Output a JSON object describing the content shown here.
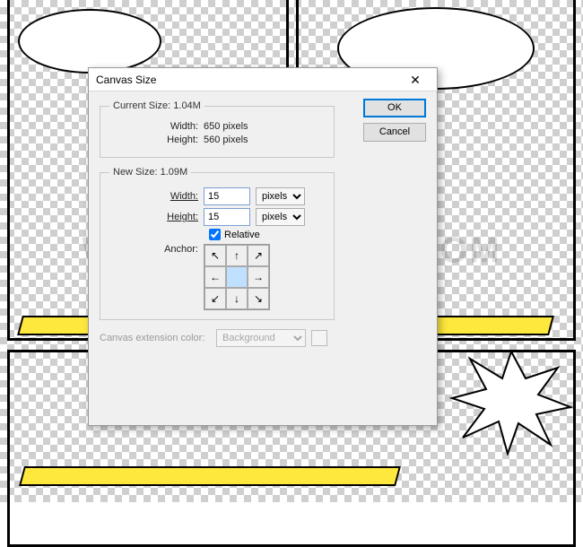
{
  "watermark": "WWW.PSD-DUDE.COM",
  "dialog": {
    "title": "Canvas Size",
    "close_glyph": "✕",
    "current": {
      "legend": "Current Size:",
      "size": "1.04M",
      "width_label": "Width:",
      "width_value": "650 pixels",
      "height_label": "Height:",
      "height_value": "560 pixels"
    },
    "newsize": {
      "legend": "New Size:",
      "size": "1.09M",
      "width_label": "Width:",
      "width_value": "15",
      "width_unit": "pixels",
      "height_label": "Height:",
      "height_value": "15",
      "height_unit": "pixels",
      "relative_label": "Relative",
      "relative_checked": true,
      "anchor_label": "Anchor:",
      "anchor_glyphs": [
        "↖",
        "↑",
        "↗",
        "←",
        "",
        "→",
        "↙",
        "↓",
        "↘"
      ]
    },
    "ext": {
      "label": "Canvas extension color:",
      "value": "Background"
    },
    "buttons": {
      "ok": "OK",
      "cancel": "Cancel"
    }
  }
}
